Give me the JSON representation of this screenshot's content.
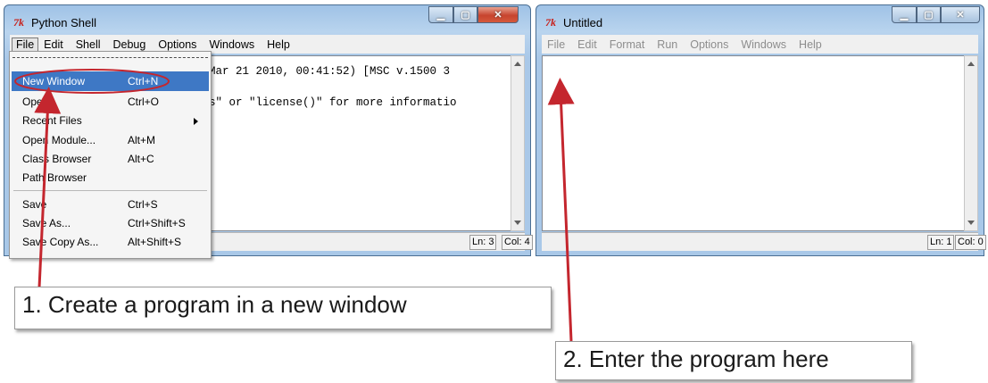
{
  "colors": {
    "highlight": "#3e78c5",
    "annotation_red": "#c4262e",
    "close_button": "#c7442e",
    "title_bar": "#a9c8e8"
  },
  "shell_window": {
    "icon_text": "7k",
    "title": "Python Shell",
    "menu": [
      "File",
      "Edit",
      "Shell",
      "Debug",
      "Options",
      "Windows",
      "Help"
    ],
    "lines": [
      "Mar 21 2010, 00:41:52) [MSC v.1500 3",
      "s\" or \"license()\" for more informatio"
    ],
    "status_ln": "Ln: 3",
    "status_col": "Col: 4"
  },
  "file_menu": {
    "items": [
      {
        "label": "New Window",
        "accel": "Ctrl+N"
      },
      {
        "label": "Open...",
        "accel": "Ctrl+O"
      },
      {
        "label": "Recent Files",
        "accel": ""
      },
      {
        "label": "Open Module...",
        "accel": "Alt+M"
      },
      {
        "label": "Class Browser",
        "accel": "Alt+C"
      },
      {
        "label": "Path Browser",
        "accel": ""
      },
      {
        "label": "Save",
        "accel": "Ctrl+S"
      },
      {
        "label": "Save As...",
        "accel": "Ctrl+Shift+S"
      },
      {
        "label": "Save Copy As...",
        "accel": "Alt+Shift+S"
      }
    ]
  },
  "untitled_window": {
    "icon_text": "7k",
    "title": "Untitled",
    "menu": [
      "File",
      "Edit",
      "Format",
      "Run",
      "Options",
      "Windows",
      "Help"
    ],
    "status_ln": "Ln: 1",
    "status_col": "Col: 0"
  },
  "callouts": {
    "first": "1. Create a program in a new window",
    "second": "2. Enter the program here"
  },
  "icons": {
    "minimize": "minimize-icon",
    "maximize": "maximize-icon",
    "close": "close-icon",
    "scroll_up": "scroll-up-arrow-icon",
    "scroll_down": "scroll-down-arrow-icon",
    "submenu": "submenu-arrow-icon"
  }
}
